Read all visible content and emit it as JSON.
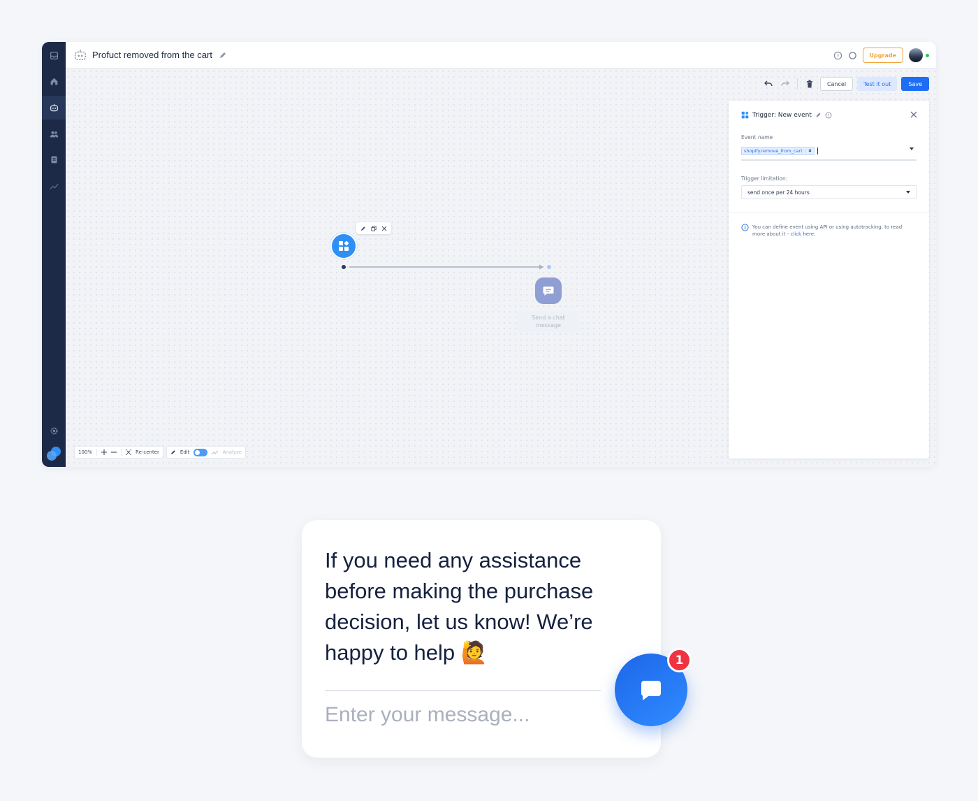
{
  "app": {
    "title": "Profuct removed from the cart",
    "upgrade_label": "Upgrade",
    "toolbar": {
      "cancel_label": "Cancel",
      "test_label": "Test it out",
      "save_label": "Save"
    },
    "flow": {
      "action_node_label": "Send a chat message"
    },
    "panel": {
      "title": "Trigger: New event",
      "event_name_label": "Event name",
      "event_chip": "shopify.remove_from_cart",
      "trigger_limitation_label": "Trigger limitation:",
      "trigger_limitation_value": "send once per 24 hours",
      "info_text": "You can define event using API or using autotracking, to read more about it - ",
      "info_link": "click here."
    },
    "zoombar": {
      "zoom_level": "100%",
      "recenter_label": "Re-center",
      "edit_label": "Edit",
      "analyze_label": "Analyze"
    },
    "colors": {
      "sidebar": "#1c2a47",
      "accent": "#1d6ef5",
      "upgrade": "#f2a33a"
    }
  },
  "chat_widget": {
    "message": "If you need any assistance before making the purchase decision, let us know! We’re happy to help 🙋",
    "input_placeholder": "Enter your message...",
    "badge_count": "1"
  }
}
